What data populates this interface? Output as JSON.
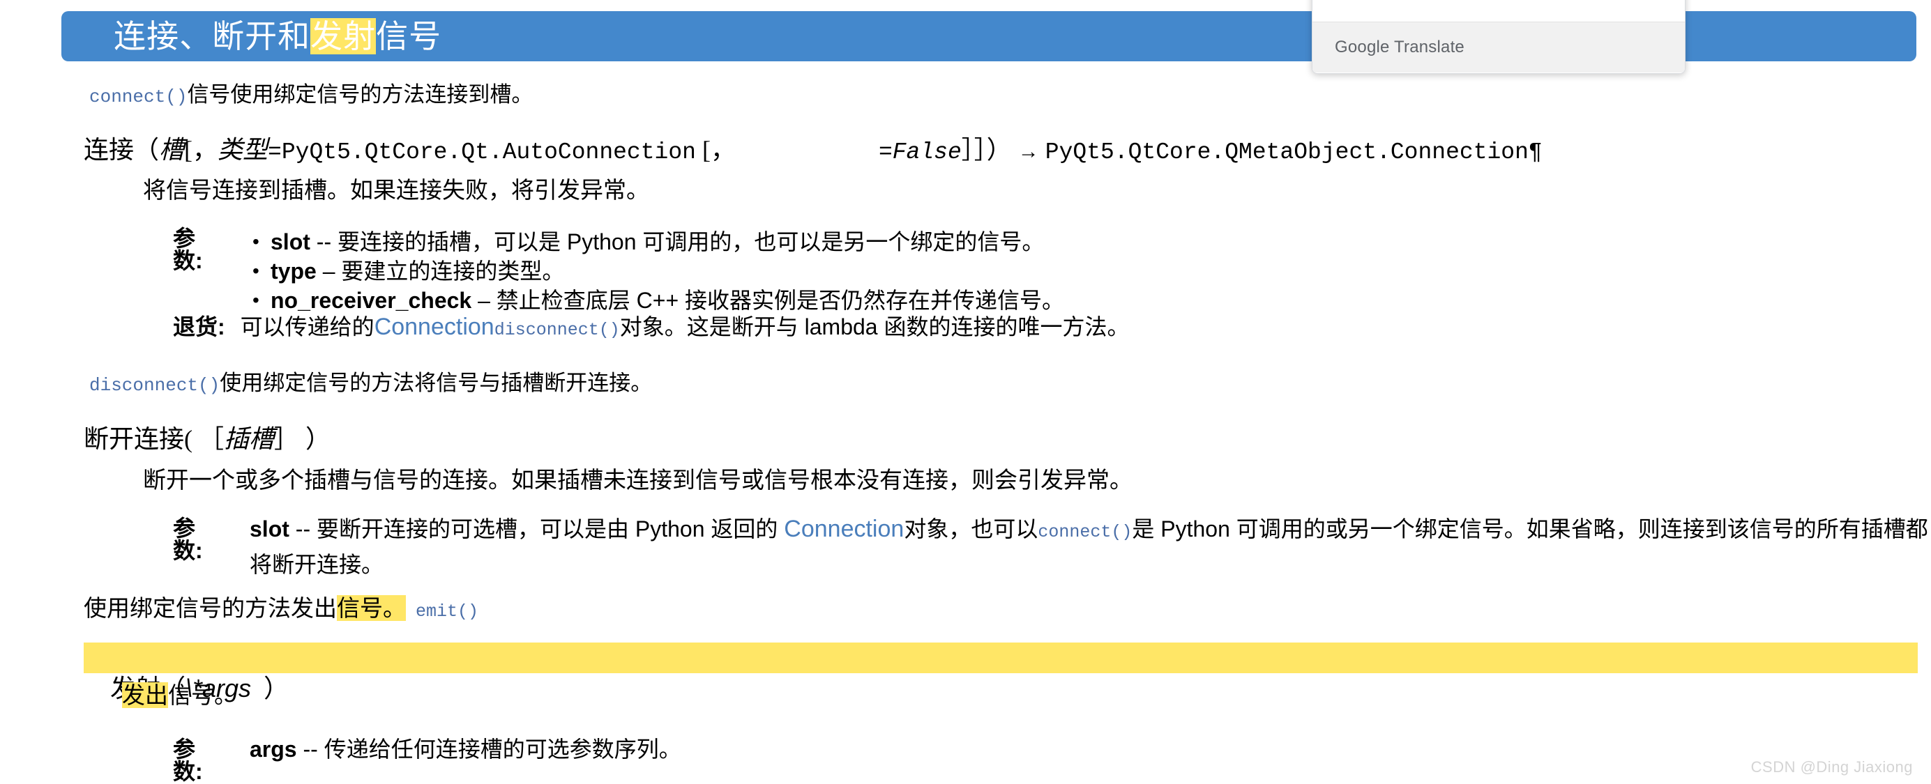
{
  "title": {
    "prefix": "连接、断开和",
    "highlight": "发射",
    "suffix": "信号"
  },
  "translate_popup": {
    "brand_bold": "Google",
    "brand_rest": " Translate"
  },
  "connect": {
    "intro_code": "connect()",
    "intro_text": "信号使用绑定信号的方法连接到槽。",
    "signature": {
      "name": "连接（",
      "arg1": "槽",
      "sep1": "[，",
      "arg2_label": "类型",
      "arg2_default": "=PyQt5.QtCore.Qt.AutoConnection",
      "bracket_open2": "[，",
      "arg3_default": "=False",
      "brackets_close": "］］）",
      "arrow": "→",
      "return_type": "PyQt5.QtCore.QMetaObject.Connection¶"
    },
    "description": "将信号连接到插槽。如果连接失败，将引发异常。",
    "params_label": "参数:",
    "params": [
      {
        "name": "slot",
        "dash": "--",
        "text": "要连接的插槽，可以是 Python 可调用的，也可以是另一个绑定的信号。"
      },
      {
        "name": "type",
        "dash": "–",
        "text": "要建立的连接的类型。"
      },
      {
        "name": "no_receiver_check",
        "dash": "–",
        "text": "禁止检查底层 C++ 接收器实例是否仍然存在并传递信号。"
      }
    ],
    "returns_label": "退货:",
    "returns_pre": "可以传递给的",
    "returns_link": "Connection",
    "returns_code": "disconnect()",
    "returns_post": "对象。这是断开与 lambda 函数的连接的唯一方法。"
  },
  "disconnect": {
    "intro_code": "disconnect()",
    "intro_text": "使用绑定信号的方法将信号与插槽断开连接。",
    "signature": {
      "name": "断开连接(",
      "bracket_open": "［",
      "arg1": "插槽",
      "bracket_close": "］",
      "paren_close": "）"
    },
    "description": "断开一个或多个插槽与信号的连接。如果插槽未连接到信号或信号根本没有连接，则会引发异常。",
    "params_label": "参数:",
    "param_name": "slot",
    "param_dash": "--",
    "param_text_1": "要断开连接的可选槽，可以是由 Python 返回的 ",
    "param_link": "Connection",
    "param_text_2": "对象，也可以",
    "param_code": "connect()",
    "param_text_3": "是 Python 可调用的或另一个绑定信号。如果省略，则连接到该信号的所有插槽都",
    "param_text_4": "将断开连接。"
  },
  "emit": {
    "intro_pre": "使用绑定信号的方法发出",
    "intro_highlight": "信号。",
    "intro_code": "emit()",
    "signature": {
      "name": "发射（",
      "args": "\\*args",
      "paren_close": "）"
    },
    "description_highlight": "发出",
    "description_rest": "信号。",
    "params_label": "参数:",
    "param_name": "args",
    "param_dash": "--",
    "param_text": "传递给任何连接槽的可选参数序列。"
  },
  "watermark": "CSDN @Ding Jiaxiong",
  "colors": {
    "banner": "#4488cc",
    "highlight": "#ffe666",
    "code_link": "#4a6ea8",
    "link": "#4a7ebb"
  }
}
